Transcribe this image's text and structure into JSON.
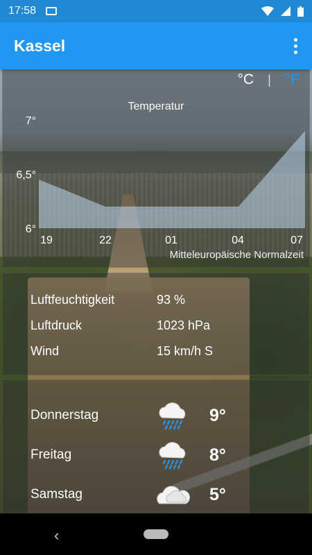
{
  "status_bar": {
    "time": "17:58",
    "icons": [
      "mail-icon",
      "wifi-icon",
      "signal-icon",
      "battery-icon"
    ]
  },
  "app_bar": {
    "title": "Kassel",
    "menu_icon": "more-vert-icon"
  },
  "units": {
    "celsius": "°C",
    "separator": "|",
    "fahrenheit": "°F",
    "active": "°C",
    "inactive_color": "#2196f3"
  },
  "chart_data": {
    "type": "area",
    "title": "Temperatur",
    "x_tick_labels": [
      "19",
      "22",
      "01",
      "04",
      "07"
    ],
    "y_tick_labels": [
      "7°",
      "6,5°",
      "6°"
    ],
    "ylim": [
      6,
      7
    ],
    "x": [
      "19",
      "22",
      "01",
      "04",
      "07"
    ],
    "series": [
      {
        "values": [
          6.45,
          6.2,
          6.2,
          6.2,
          6.9
        ]
      }
    ],
    "note": "Mitteleuropäische Normalzeit"
  },
  "details": [
    {
      "label": "Luftfeuchtigkeit",
      "value": "93 %"
    },
    {
      "label": "Luftdruck",
      "value": "1023 hPa"
    },
    {
      "label": "Wind",
      "value": "15 km/h S"
    }
  ],
  "forecast": [
    {
      "day": "Donnerstag",
      "temp": "9°",
      "icon": "rain-cloud-icon"
    },
    {
      "day": "Freitag",
      "temp": "8°",
      "icon": "rain-cloud-icon"
    },
    {
      "day": "Samstag",
      "temp": "5°",
      "icon": "cloud-icon"
    }
  ],
  "nav_bar": {
    "back_icon": "‹"
  }
}
